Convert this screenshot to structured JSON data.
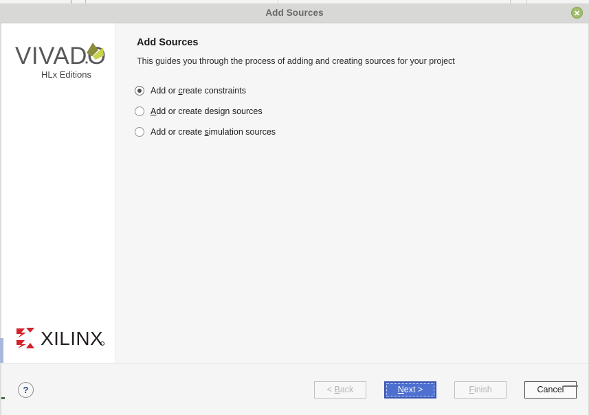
{
  "window": {
    "title": "Add Sources",
    "close_icon": "close-icon"
  },
  "sidebar": {
    "product_logo": {
      "name": "VIVADO",
      "wordmark": "VIVADO",
      "subtitle": "HLx Editions",
      "leaf_dark_color": "#8b8c3a",
      "leaf_light_color": "#c9d24b"
    },
    "company_logo": {
      "name": "XILINX",
      "wordmark": "XILINX",
      "registered_mark": "®",
      "mark_color": "#d2222a",
      "wordmark_color": "#231f20"
    }
  },
  "content": {
    "heading": "Add Sources",
    "description": "This guides you through the process of adding and creating sources for your project",
    "options": [
      {
        "id": "add-or-create-constraints",
        "label": "Add or create constraints",
        "pre": "Add or ",
        "mnemonic": "c",
        "post": "reate constraints",
        "selected": true
      },
      {
        "id": "add-or-create-design-sources",
        "label": "Add or create design sources",
        "pre": "",
        "mnemonic": "A",
        "post": "dd or create design sources",
        "selected": false
      },
      {
        "id": "add-or-create-simulation-sources",
        "label": "Add or create simulation sources",
        "pre": "Add or create ",
        "mnemonic": "s",
        "post": "imulation sources",
        "selected": false
      }
    ]
  },
  "footer": {
    "help_label": "?",
    "buttons": [
      {
        "id": "back",
        "label": "< Back",
        "pre": "< ",
        "mnemonic": "B",
        "post": "ack",
        "state": "disabled"
      },
      {
        "id": "next",
        "label": "Next >",
        "pre": "",
        "mnemonic": "N",
        "post": "ext >",
        "state": "primary"
      },
      {
        "id": "finish",
        "label": "Finish",
        "pre": "",
        "mnemonic": "F",
        "post": "inish",
        "state": "disabled"
      },
      {
        "id": "cancel",
        "label": "Cancel",
        "pre": "Cancel",
        "mnemonic": "",
        "post": "",
        "state": "enabled"
      }
    ]
  },
  "colors": {
    "titlebar": "#d8d8d6",
    "dialog_bg": "#f5f5f5",
    "sidebar_bg": "#ffffff",
    "primary_button": "#4c6fd0",
    "close_button": "#9fbd6b"
  }
}
